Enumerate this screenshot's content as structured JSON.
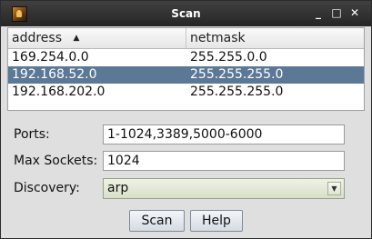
{
  "window": {
    "title": "Scan",
    "app_icon": "app-icon",
    "controls": {
      "minimize": "_",
      "maximize": "□",
      "close": "✕"
    }
  },
  "table": {
    "columns": [
      {
        "label": "address",
        "sort": "ascending"
      },
      {
        "label": "netmask"
      }
    ],
    "sort_indicator": "▲",
    "rows": [
      {
        "address": "169.254.0.0",
        "netmask": "255.255.0.0",
        "selected": false
      },
      {
        "address": "192.168.52.0",
        "netmask": "255.255.255.0",
        "selected": true
      },
      {
        "address": "192.168.202.0",
        "netmask": "255.255.255.0",
        "selected": false
      }
    ],
    "selection_color": "#5b7896"
  },
  "form": {
    "ports": {
      "label": "Ports:",
      "value": "1-1024,3389,5000-6000"
    },
    "max_sockets": {
      "label": "Max Sockets:",
      "value": "1024"
    },
    "discovery": {
      "label": "Discovery:",
      "value": "arp",
      "arrow": "▼"
    }
  },
  "buttons": {
    "scan": "Scan",
    "help": "Help"
  }
}
